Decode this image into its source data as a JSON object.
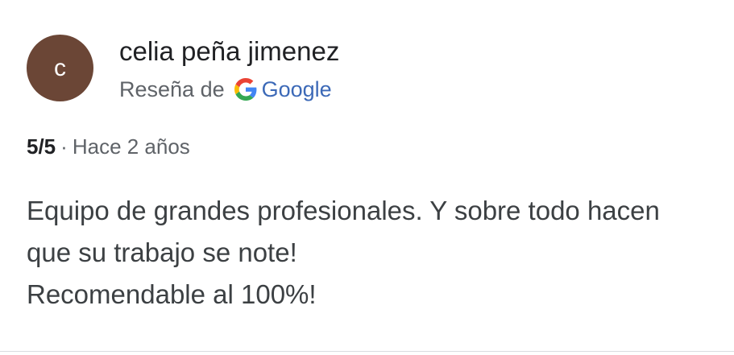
{
  "review": {
    "avatar_letter": "c",
    "avatar_color": "#6b4636",
    "author_name": "celia peña jimenez",
    "source_prefix": "Reseña de",
    "source_icon": "google-g-icon",
    "source_brand": "Google",
    "rating": "5/5",
    "separator": "·",
    "time_ago": "Hace 2 años",
    "text_lines": [
      "Equipo de grandes profesionales. Y sobre todo hacen",
      "que su trabajo se note!",
      "Recomendable al 100%!"
    ]
  },
  "colors": {
    "text_primary": "#202124",
    "text_secondary": "#5f6368",
    "brand_link": "#3c69b7",
    "divider": "#dadce0"
  }
}
